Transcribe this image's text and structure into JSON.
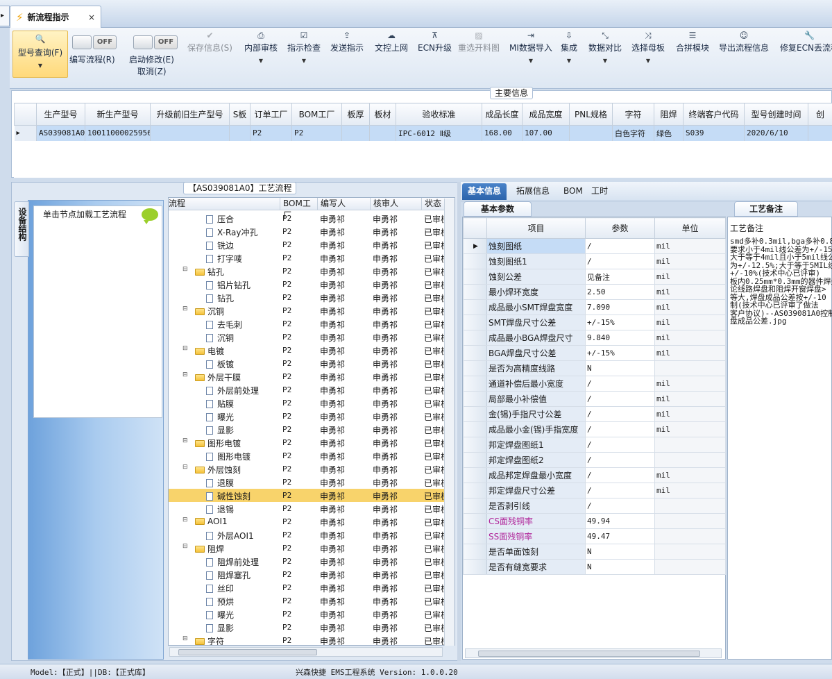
{
  "tab": {
    "title": "新流程指示",
    "close": "×"
  },
  "ribbon": {
    "query": "型号查询(F)",
    "edit_flow": "编写流程(R)",
    "toggle_off": "OFF",
    "start_modify": "启动修改(E)",
    "cancel": "取消(Z)",
    "save": "保存信息(S)",
    "internal_review": "内部审核",
    "instruction_check": "指示检查",
    "send_instruction": "发送指示",
    "upload_doc": "文控上网",
    "ecn_upgrade": "ECN升级",
    "reselect_map": "重选开料图",
    "mi_import": "MI数据导入",
    "integrate": "集成",
    "data_compare": "数据对比",
    "select_mother": "选择母板",
    "merge_module": "合拼模块",
    "export_flow": "导出流程信息",
    "repair_ecn": "修复ECN丢流程"
  },
  "main_info": {
    "label": "主要信息",
    "columns": [
      "生产型号",
      "新生产型号",
      "升级前旧生产型号",
      "S板",
      "订单工厂",
      "BOM工厂",
      "板厚",
      "板材",
      "验收标准",
      "成品长度",
      "成品宽度",
      "PNL规格",
      "字符",
      "阻焊",
      "终端客户代码",
      "型号创建时间",
      "创"
    ],
    "row": [
      "AS039081A0",
      "10011000025956",
      "",
      "",
      "P2",
      "P2",
      "",
      "",
      "IPC-6012 Ⅱ级",
      "168.00",
      "107.00",
      "",
      "白色字符",
      "绿色",
      "S039",
      "2020/6/10",
      ""
    ]
  },
  "flow_panel": {
    "title": "【AS039081A0】工艺流程",
    "vtab": "设备结构",
    "hint": "单击节点加载工艺流程",
    "columns": [
      "流程",
      "BOM工厂",
      "编写人",
      "核审人",
      "状态"
    ],
    "rows": [
      {
        "name": "压合",
        "level": 2,
        "bom": "P2",
        "writer": "申勇祁",
        "reviewer": "申勇祁",
        "status": "已审核"
      },
      {
        "name": "X-Ray冲孔",
        "level": 2,
        "bom": "P2",
        "writer": "申勇祁",
        "reviewer": "申勇祁",
        "status": "已审核"
      },
      {
        "name": "铣边",
        "level": 2,
        "bom": "P2",
        "writer": "申勇祁",
        "reviewer": "申勇祁",
        "status": "已审核"
      },
      {
        "name": "打字唛",
        "level": 2,
        "bom": "P2",
        "writer": "申勇祁",
        "reviewer": "申勇祁",
        "status": "已审核"
      },
      {
        "name": "钻孔",
        "level": 1,
        "bom": "P2",
        "writer": "申勇祁",
        "reviewer": "申勇祁",
        "status": "已审核"
      },
      {
        "name": "铝片钻孔",
        "level": 2,
        "bom": "P2",
        "writer": "申勇祁",
        "reviewer": "申勇祁",
        "status": "已审核"
      },
      {
        "name": "钻孔",
        "level": 2,
        "bom": "P2",
        "writer": "申勇祁",
        "reviewer": "申勇祁",
        "status": "已审核"
      },
      {
        "name": "沉铜",
        "level": 1,
        "bom": "P2",
        "writer": "申勇祁",
        "reviewer": "申勇祁",
        "status": "已审核"
      },
      {
        "name": "去毛刺",
        "level": 2,
        "bom": "P2",
        "writer": "申勇祁",
        "reviewer": "申勇祁",
        "status": "已审核"
      },
      {
        "name": "沉铜",
        "level": 2,
        "bom": "P2",
        "writer": "申勇祁",
        "reviewer": "申勇祁",
        "status": "已审核"
      },
      {
        "name": "电镀",
        "level": 1,
        "bom": "P2",
        "writer": "申勇祁",
        "reviewer": "申勇祁",
        "status": "已审核"
      },
      {
        "name": "板镀",
        "level": 2,
        "bom": "P2",
        "writer": "申勇祁",
        "reviewer": "申勇祁",
        "status": "已审核"
      },
      {
        "name": "外层干膜",
        "level": 1,
        "bom": "P2",
        "writer": "申勇祁",
        "reviewer": "申勇祁",
        "status": "已审核"
      },
      {
        "name": "外层前处理",
        "level": 2,
        "bom": "P2",
        "writer": "申勇祁",
        "reviewer": "申勇祁",
        "status": "已审核"
      },
      {
        "name": "贴膜",
        "level": 2,
        "bom": "P2",
        "writer": "申勇祁",
        "reviewer": "申勇祁",
        "status": "已审核"
      },
      {
        "name": "曝光",
        "level": 2,
        "bom": "P2",
        "writer": "申勇祁",
        "reviewer": "申勇祁",
        "status": "已审核"
      },
      {
        "name": "显影",
        "level": 2,
        "bom": "P2",
        "writer": "申勇祁",
        "reviewer": "申勇祁",
        "status": "已审核"
      },
      {
        "name": "图形电镀",
        "level": 1,
        "bom": "P2",
        "writer": "申勇祁",
        "reviewer": "申勇祁",
        "status": "已审核"
      },
      {
        "name": "图形电镀",
        "level": 2,
        "bom": "P2",
        "writer": "申勇祁",
        "reviewer": "申勇祁",
        "status": "已审核"
      },
      {
        "name": "外层蚀刻",
        "level": 1,
        "bom": "P2",
        "writer": "申勇祁",
        "reviewer": "申勇祁",
        "status": "已审核"
      },
      {
        "name": "退膜",
        "level": 2,
        "bom": "P2",
        "writer": "申勇祁",
        "reviewer": "申勇祁",
        "status": "已审核"
      },
      {
        "name": "碱性蚀刻",
        "level": 2,
        "bom": "P2",
        "writer": "申勇祁",
        "reviewer": "申勇祁",
        "status": "已审核",
        "selected": true
      },
      {
        "name": "退锡",
        "level": 2,
        "bom": "P2",
        "writer": "申勇祁",
        "reviewer": "申勇祁",
        "status": "已审核"
      },
      {
        "name": "AOI1",
        "level": 1,
        "bom": "P2",
        "writer": "申勇祁",
        "reviewer": "申勇祁",
        "status": "已审核"
      },
      {
        "name": "外层AOI1",
        "level": 2,
        "bom": "P2",
        "writer": "申勇祁",
        "reviewer": "申勇祁",
        "status": "已审核"
      },
      {
        "name": "阻焊",
        "level": 1,
        "bom": "P2",
        "writer": "申勇祁",
        "reviewer": "申勇祁",
        "status": "已审核"
      },
      {
        "name": "阻焊前处理",
        "level": 2,
        "bom": "P2",
        "writer": "申勇祁",
        "reviewer": "申勇祁",
        "status": "已审核"
      },
      {
        "name": "阻焊塞孔",
        "level": 2,
        "bom": "P2",
        "writer": "申勇祁",
        "reviewer": "申勇祁",
        "status": "已审核"
      },
      {
        "name": "丝印",
        "level": 2,
        "bom": "P2",
        "writer": "申勇祁",
        "reviewer": "申勇祁",
        "status": "已审核"
      },
      {
        "name": "预烘",
        "level": 2,
        "bom": "P2",
        "writer": "申勇祁",
        "reviewer": "申勇祁",
        "status": "已审核"
      },
      {
        "name": "曝光",
        "level": 2,
        "bom": "P2",
        "writer": "申勇祁",
        "reviewer": "申勇祁",
        "status": "已审核"
      },
      {
        "name": "显影",
        "level": 2,
        "bom": "P2",
        "writer": "申勇祁",
        "reviewer": "申勇祁",
        "status": "已审核"
      },
      {
        "name": "字符",
        "level": 1,
        "bom": "P2",
        "writer": "申勇祁",
        "reviewer": "申勇祁",
        "status": "已审核"
      }
    ]
  },
  "right_tabs": [
    "基本信息",
    "拓展信息",
    "BOM",
    "工时"
  ],
  "basic_params": {
    "tab": "基本参数",
    "columns": [
      "项目",
      "参数",
      "单位"
    ],
    "rows": [
      {
        "item": "蚀刻图纸",
        "value": "/",
        "unit": "mil"
      },
      {
        "item": "蚀刻图纸1",
        "value": "/",
        "unit": "mil"
      },
      {
        "item": "蚀刻公差",
        "value": "见备注",
        "unit": "mil"
      },
      {
        "item": "最小焊环宽度",
        "value": "2.50",
        "unit": "mil"
      },
      {
        "item": "成品最小SMT焊盘宽度",
        "value": "7.090",
        "unit": "mil"
      },
      {
        "item": "SMT焊盘尺寸公差",
        "value": "+/-15%",
        "unit": "mil"
      },
      {
        "item": "成品最小BGA焊盘尺寸",
        "value": "9.840",
        "unit": "mil"
      },
      {
        "item": "BGA焊盘尺寸公差",
        "value": "+/-15%",
        "unit": "mil"
      },
      {
        "item": "是否为高精度线路",
        "value": "N",
        "unit": ""
      },
      {
        "item": "通道补偿后最小宽度",
        "value": "/",
        "unit": "mil"
      },
      {
        "item": "局部最小补偿值",
        "value": "/",
        "unit": "mil"
      },
      {
        "item": "金(锡)手指尺寸公差",
        "value": "/",
        "unit": "mil"
      },
      {
        "item": "成品最小金(锡)手指宽度",
        "value": "/",
        "unit": "mil"
      },
      {
        "item": "邦定焊盘图纸1",
        "value": "/",
        "unit": ""
      },
      {
        "item": "邦定焊盘图纸2",
        "value": "/",
        "unit": ""
      },
      {
        "item": "成品邦定焊盘最小宽度",
        "value": "/",
        "unit": "mil"
      },
      {
        "item": "邦定焊盘尺寸公差",
        "value": "/",
        "unit": "mil"
      },
      {
        "item": "是否剥引线",
        "value": "/",
        "unit": ""
      },
      {
        "item": "CS面残铜率",
        "value": "49.94",
        "unit": "",
        "highlight": true
      },
      {
        "item": "SS面残铜率",
        "value": "49.47",
        "unit": "",
        "highlight": true
      },
      {
        "item": "是否单面蚀刻",
        "value": "N",
        "unit": ""
      },
      {
        "item": "是否有缝宽要求",
        "value": "N",
        "unit": ""
      }
    ]
  },
  "process_note": {
    "tab": "工艺备注",
    "label": "工艺备注",
    "text": "smd多补0.3mil,bga多补0.8m\n要求小于4mil线公差为+/-15\n大于等于4mil且小于5mil线公\n为+/-12.5%;大于等于5MIL线\n+/-10%(技术中心已评审)\n板内0.25mm*0.3mm的器件焊盘\n论线路焊盘和阻焊开窗焊盘>\n等大,焊盘成品公差按+/-10\n制(技术中心已评审了做法\n客户协议)--AS039081A0控制\n盘成品公差.jpg"
  },
  "status": {
    "model": "Model:【正式】||DB:【正式库】",
    "system": "兴森快捷 EMS工程系统 Version: 1.0.0.20"
  }
}
